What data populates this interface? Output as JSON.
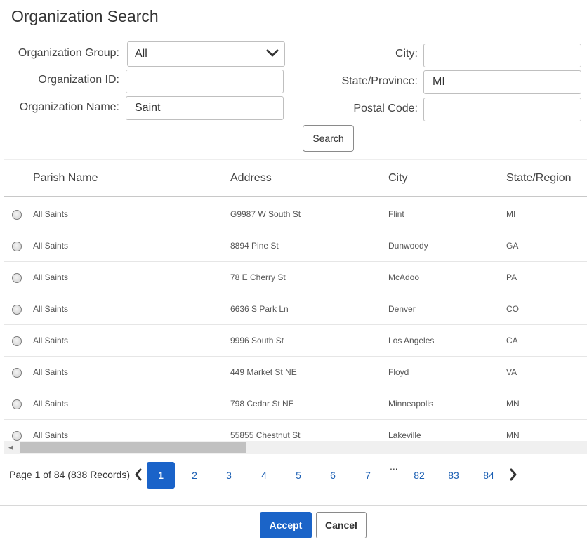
{
  "dialog": {
    "title": "Organization Search"
  },
  "form": {
    "org_group_label": "Organization Group:",
    "org_group_value": "All",
    "org_id_label": "Organization ID:",
    "org_id_value": "",
    "org_name_label": "Organization Name:",
    "org_name_value": "Saint",
    "city_label": "City:",
    "city_value": "",
    "state_label": "State/Province:",
    "state_value": "MI",
    "postal_label": "Postal Code:",
    "postal_value": "",
    "search_label": "Search"
  },
  "table": {
    "columns": [
      "Parish Name",
      "Address",
      "City",
      "State/Region"
    ],
    "rows": [
      {
        "name": "All Saints",
        "address": "G9987 W South St",
        "city": "Flint",
        "state": "MI"
      },
      {
        "name": "All Saints",
        "address": "8894 Pine St",
        "city": "Dunwoody",
        "state": "GA"
      },
      {
        "name": "All Saints",
        "address": "78 E Cherry St",
        "city": "McAdoo",
        "state": "PA"
      },
      {
        "name": "All Saints",
        "address": "6636 S Park Ln",
        "city": "Denver",
        "state": "CO"
      },
      {
        "name": "All Saints",
        "address": "9996 South St",
        "city": "Los Angeles",
        "state": "CA"
      },
      {
        "name": "All Saints",
        "address": "449 Market St NE",
        "city": "Floyd",
        "state": "VA"
      },
      {
        "name": "All Saints",
        "address": "798 Cedar St NE",
        "city": "Minneapolis",
        "state": "MN"
      },
      {
        "name": "All Saints",
        "address": "55855 Chestnut St",
        "city": "Lakeville",
        "state": "MN"
      }
    ]
  },
  "pager": {
    "summary": "Page 1 of 84 (838 Records)",
    "pages": [
      "1",
      "2",
      "3",
      "4",
      "5",
      "6",
      "7"
    ],
    "ellipsis": "...",
    "last_pages": [
      "82",
      "83",
      "84"
    ],
    "current_page": 1
  },
  "footer": {
    "accept_label": "Accept",
    "cancel_label": "Cancel"
  },
  "colors": {
    "primary": "#1b64c8",
    "link": "#1b5fb3"
  },
  "icons": {
    "dropdown": "chevron-down-icon",
    "prev": "chevron-left-icon",
    "next": "chevron-right-icon",
    "scroll_left": "triangle-left-icon"
  }
}
